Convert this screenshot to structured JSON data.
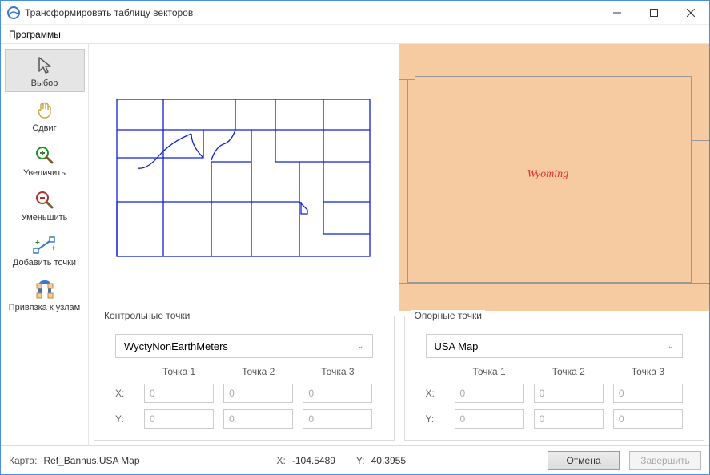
{
  "window": {
    "title": "Трансформировать таблицу векторов"
  },
  "menu": {
    "programs": "Программы"
  },
  "tools": {
    "select": "Выбор",
    "pan": "Сдвиг",
    "zoom_in": "Увеличить",
    "zoom_out": "Уменьшить",
    "add_points": "Добавить точки",
    "snap_to_nodes": "Привязка к узлам"
  },
  "map": {
    "right_label": "Wyoming"
  },
  "control_points": {
    "legend": "Контрольные точки",
    "dropdown": "WyctyNonEarthMeters",
    "headers": {
      "p1": "Точка 1",
      "p2": "Точка 2",
      "p3": "Точка 3"
    },
    "rows": {
      "x": {
        "label": "X:",
        "p1": "0",
        "p2": "0",
        "p3": "0"
      },
      "y": {
        "label": "Y:",
        "p1": "0",
        "p2": "0",
        "p3": "0"
      }
    }
  },
  "reference_points": {
    "legend": "Опорные точки",
    "dropdown": "USA Map",
    "headers": {
      "p1": "Точка 1",
      "p2": "Точка 2",
      "p3": "Точка 3"
    },
    "rows": {
      "x": {
        "label": "X:",
        "p1": "0",
        "p2": "0",
        "p3": "0"
      },
      "y": {
        "label": "Y:",
        "p1": "0",
        "p2": "0",
        "p3": "0"
      }
    }
  },
  "status": {
    "map_label": "Карта:",
    "map_value": "Ref_Bannus,USA Map",
    "x_label": "X:",
    "x_value": "-104.5489",
    "y_label": "Y:",
    "y_value": "40.3955"
  },
  "buttons": {
    "cancel": "Отмена",
    "finish": "Завершить"
  }
}
